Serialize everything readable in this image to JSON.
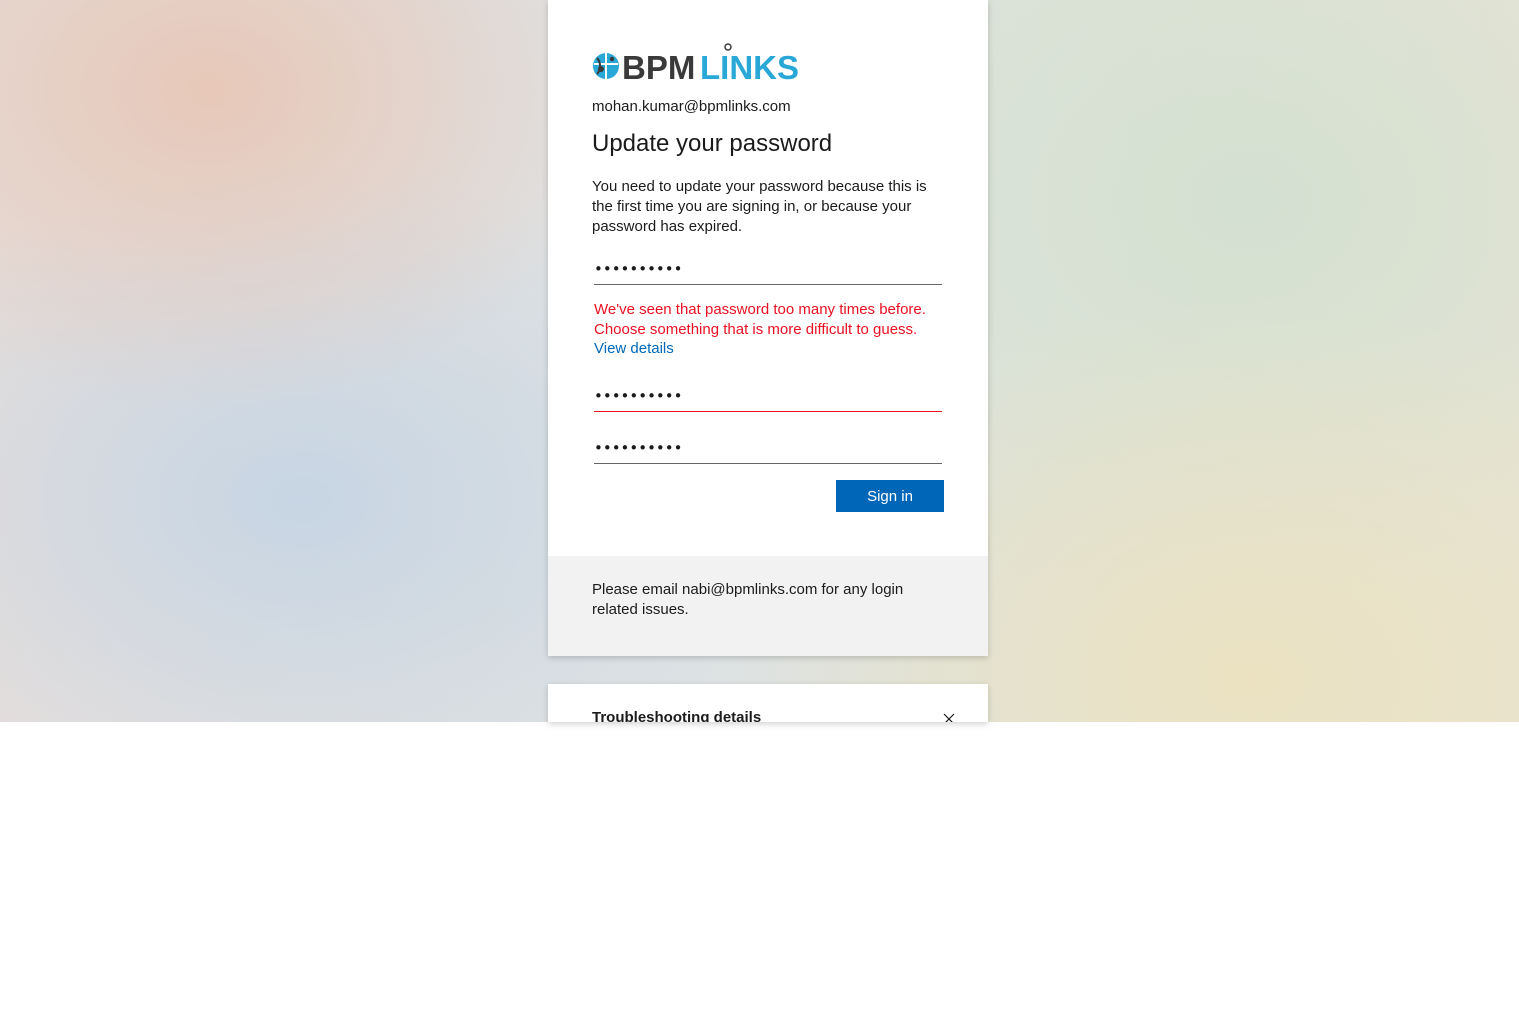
{
  "brand": {
    "logo_text_dark": "BPM",
    "logo_text_light": "LINKS",
    "logo_dark_color": "#3a3a3a",
    "logo_accent_color": "#29a8d8"
  },
  "account": {
    "email": "mohan.kumar@bpmlinks.com"
  },
  "page": {
    "title": "Update your password",
    "description": "You need to update your password because this is the first time you are signing in, or because your password has expired."
  },
  "form": {
    "current_password_mask": "••••••••••",
    "new_password_mask": "••••••••••",
    "confirm_password_mask": "••••••••••",
    "error_message": "We've seen that password too many times before. Choose something that is more difficult to guess.",
    "view_details_label": "View details",
    "submit_label": "Sign in"
  },
  "footer": {
    "help_text": "Please email nabi@bpmlinks.com for any login related issues."
  },
  "troubleshooting": {
    "title": "Troubleshooting details",
    "close_icon": "close-icon"
  },
  "colors": {
    "accent": "#0067b8",
    "error": "#e81123"
  }
}
